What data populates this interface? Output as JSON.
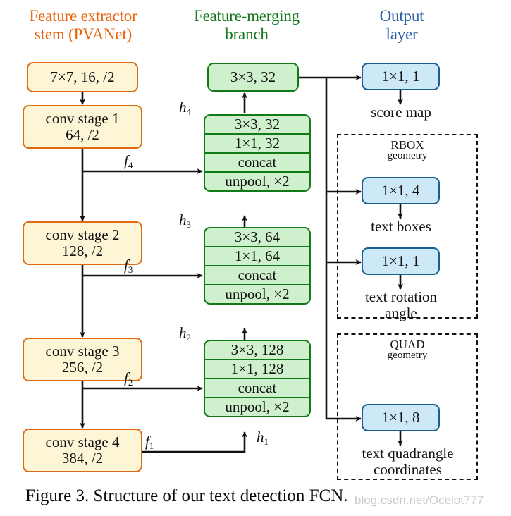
{
  "figure": {
    "caption": "Figure 3. Structure of our text detection FCN.",
    "watermark": "blog.csdn.net/Ocelot777"
  },
  "colors": {
    "stem_accent": "#E8620C",
    "merge_accent": "#15761F",
    "output_accent": "#2E62A8",
    "stem_fill": "#FDF6D6",
    "stem_border": "#E06A12",
    "merge_fill": "#CFF0CC",
    "merge_border": "#117A16",
    "output_fill": "#CDE8F7",
    "output_border": "#17608F",
    "wire": "#111111"
  },
  "columns": {
    "stem": {
      "title_line1": "Feature extractor",
      "title_line2": "stem (PVANet)"
    },
    "merging": {
      "title_line1": "Feature-merging",
      "title_line2": "branch"
    },
    "output": {
      "title_line1": "Output",
      "title_line2": "layer"
    }
  },
  "stem": {
    "nodes": [
      {
        "line1": "7×7, 16, /2",
        "line2": ""
      },
      {
        "line1": "conv stage 1",
        "line2": "64, /2"
      },
      {
        "line1": "conv stage 2",
        "line2": "128, /2"
      },
      {
        "line1": "conv stage 3",
        "line2": "256, /2"
      },
      {
        "line1": "conv stage 4",
        "line2": "384, /2"
      }
    ],
    "feature_labels": [
      {
        "name": "f",
        "sub": "4"
      },
      {
        "name": "f",
        "sub": "3"
      },
      {
        "name": "f",
        "sub": "2"
      },
      {
        "name": "f",
        "sub": "1"
      }
    ]
  },
  "merging": {
    "head_node": "3×3, 32",
    "stacks": [
      {
        "label": {
          "name": "h",
          "sub": "4"
        },
        "rows": [
          "3×3, 32",
          "1×1, 32",
          "concat",
          "unpool, ×2"
        ]
      },
      {
        "label": {
          "name": "h",
          "sub": "3"
        },
        "rows": [
          "3×3, 64",
          "1×1, 64",
          "concat",
          "unpool, ×2"
        ]
      },
      {
        "label": {
          "name": "h",
          "sub": "2"
        },
        "rows": [
          "3×3, 128",
          "1×1, 128",
          "concat",
          "unpool, ×2"
        ]
      }
    ],
    "input_label": {
      "name": "h",
      "sub": "1"
    }
  },
  "output": {
    "score": {
      "node": "1×1, 1",
      "caption": "score map"
    },
    "rbox": {
      "group_title_line1": "RBOX",
      "group_title_line2": "geometry",
      "items": [
        {
          "node": "1×1, 4",
          "caption_line1": "text boxes",
          "caption_line2": ""
        },
        {
          "node": "1×1, 1",
          "caption_line1": "text rotation",
          "caption_line2": "angle"
        }
      ]
    },
    "quad": {
      "group_title_line1": "QUAD",
      "group_title_line2": "geometry",
      "items": [
        {
          "node": "1×1, 8",
          "caption_line1": "text quadrangle",
          "caption_line2": "coordinates"
        }
      ]
    }
  }
}
